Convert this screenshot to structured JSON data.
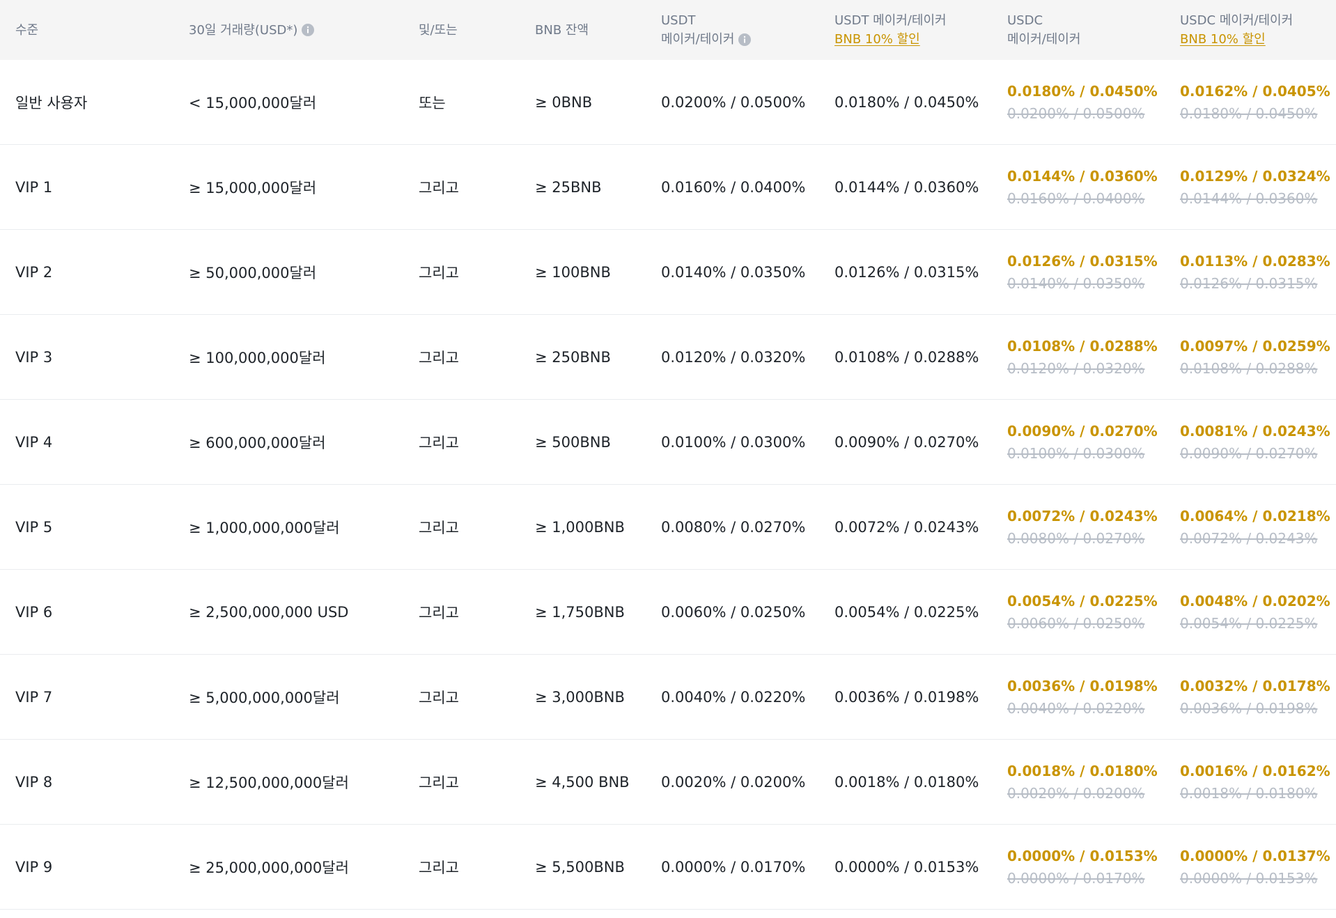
{
  "header": {
    "col0": "수준",
    "col1": "30일 거래량(USD*)",
    "col2": "및/또는",
    "col3": "BNB 잔액",
    "col4_line1": "USDT",
    "col4_line2": "메이커/테이커",
    "col5_line1": "USDT 메이커/테이커",
    "col5_link": "BNB 10% 할인",
    "col6_line1": "USDC",
    "col6_line2": "메이커/테이커",
    "col7_line1": "USDC 메이커/테이커",
    "col7_link": "BNB 10% 할인"
  },
  "rows": [
    {
      "level": "일반 사용자",
      "volume": "< 15,000,000달러",
      "cond": "또는",
      "bnb": "≥ 0BNB",
      "usdt": "0.0200% / 0.0500%",
      "usdt_bnb": "0.0180% / 0.0450%",
      "usdc_disc": "0.0180% / 0.0450%",
      "usdc_orig": "0.0200% / 0.0500%",
      "usdc_bnb_disc": "0.0162% / 0.0405%",
      "usdc_bnb_orig": "0.0180% / 0.0450%"
    },
    {
      "level": "VIP 1",
      "volume": "≥ 15,000,000달러",
      "cond": "그리고",
      "bnb": "≥ 25BNB",
      "usdt": "0.0160% / 0.0400%",
      "usdt_bnb": "0.0144% / 0.0360%",
      "usdc_disc": "0.0144% / 0.0360%",
      "usdc_orig": "0.0160% / 0.0400%",
      "usdc_bnb_disc": "0.0129% / 0.0324%",
      "usdc_bnb_orig": "0.0144% / 0.0360%"
    },
    {
      "level": "VIP 2",
      "volume": "≥ 50,000,000달러",
      "cond": "그리고",
      "bnb": "≥ 100BNB",
      "usdt": "0.0140% / 0.0350%",
      "usdt_bnb": "0.0126% / 0.0315%",
      "usdc_disc": "0.0126% / 0.0315%",
      "usdc_orig": "0.0140% / 0.0350%",
      "usdc_bnb_disc": "0.0113% / 0.0283%",
      "usdc_bnb_orig": "0.0126% / 0.0315%"
    },
    {
      "level": "VIP 3",
      "volume": "≥ 100,000,000달러",
      "cond": "그리고",
      "bnb": "≥ 250BNB",
      "usdt": "0.0120% / 0.0320%",
      "usdt_bnb": "0.0108% / 0.0288%",
      "usdc_disc": "0.0108% / 0.0288%",
      "usdc_orig": "0.0120% / 0.0320%",
      "usdc_bnb_disc": "0.0097% / 0.0259%",
      "usdc_bnb_orig": "0.0108% / 0.0288%"
    },
    {
      "level": "VIP 4",
      "volume": "≥ 600,000,000달러",
      "cond": "그리고",
      "bnb": "≥ 500BNB",
      "usdt": "0.0100% / 0.0300%",
      "usdt_bnb": "0.0090% / 0.0270%",
      "usdc_disc": "0.0090% / 0.0270%",
      "usdc_orig": "0.0100% / 0.0300%",
      "usdc_bnb_disc": "0.0081% / 0.0243%",
      "usdc_bnb_orig": "0.0090% / 0.0270%"
    },
    {
      "level": "VIP 5",
      "volume": "≥ 1,000,000,000달러",
      "cond": "그리고",
      "bnb": "≥ 1,000BNB",
      "usdt": "0.0080% / 0.0270%",
      "usdt_bnb": "0.0072% / 0.0243%",
      "usdc_disc": "0.0072% / 0.0243%",
      "usdc_orig": "0.0080% / 0.0270%",
      "usdc_bnb_disc": "0.0064% / 0.0218%",
      "usdc_bnb_orig": "0.0072% / 0.0243%"
    },
    {
      "level": "VIP 6",
      "volume": "≥ 2,500,000,000 USD",
      "cond": "그리고",
      "bnb": "≥ 1,750BNB",
      "usdt": "0.0060% / 0.0250%",
      "usdt_bnb": "0.0054% / 0.0225%",
      "usdc_disc": "0.0054% / 0.0225%",
      "usdc_orig": "0.0060% / 0.0250%",
      "usdc_bnb_disc": "0.0048% / 0.0202%",
      "usdc_bnb_orig": "0.0054% / 0.0225%"
    },
    {
      "level": "VIP 7",
      "volume": "≥ 5,000,000,000달러",
      "cond": "그리고",
      "bnb": "≥ 3,000BNB",
      "usdt": "0.0040% / 0.0220%",
      "usdt_bnb": "0.0036% / 0.0198%",
      "usdc_disc": "0.0036% / 0.0198%",
      "usdc_orig": "0.0040% / 0.0220%",
      "usdc_bnb_disc": "0.0032% / 0.0178%",
      "usdc_bnb_orig": "0.0036% / 0.0198%"
    },
    {
      "level": "VIP 8",
      "volume": "≥ 12,500,000,000달러",
      "cond": "그리고",
      "bnb": "≥ 4,500 BNB",
      "usdt": "0.0020% / 0.0200%",
      "usdt_bnb": "0.0018% / 0.0180%",
      "usdc_disc": "0.0018% / 0.0180%",
      "usdc_orig": "0.0020% / 0.0200%",
      "usdc_bnb_disc": "0.0016% / 0.0162%",
      "usdc_bnb_orig": "0.0018% / 0.0180%"
    },
    {
      "level": "VIP 9",
      "volume": "≥ 25,000,000,000달러",
      "cond": "그리고",
      "bnb": "≥ 5,500BNB",
      "usdt": "0.0000% / 0.0170%",
      "usdt_bnb": "0.0000% / 0.0153%",
      "usdc_disc": "0.0000% / 0.0153%",
      "usdc_orig": "0.0000% / 0.0170%",
      "usdc_bnb_disc": "0.0000% / 0.0137%",
      "usdc_bnb_orig": "0.0000% / 0.0153%"
    }
  ]
}
